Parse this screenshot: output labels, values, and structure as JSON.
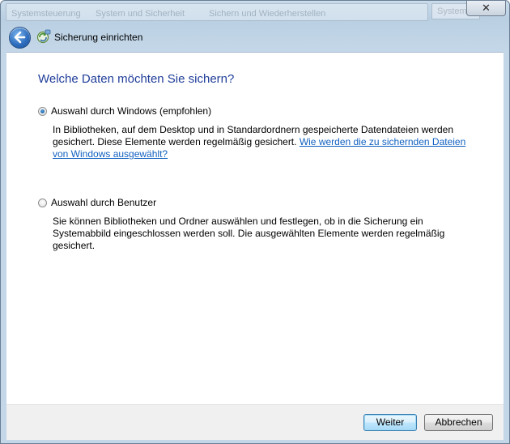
{
  "window": {
    "close_glyph": "✕",
    "background_breadcrumb": [
      "Systemsteuerung",
      "System und Sicherheit",
      "Sichern und Wiederherstellen"
    ],
    "background_search": "Systemste"
  },
  "dialog": {
    "title": "Sicherung einrichten",
    "heading": "Welche Daten möchten Sie sichern?",
    "options": [
      {
        "label": "Auswahl durch Windows (empfohlen)",
        "selected": true,
        "description_line1": "In Bibliotheken, auf dem Desktop und in Standardordnern gespeicherte Datendateien werden",
        "description_line2_text": "gesichert. Diese Elemente werden regelmäßig gesichert. ",
        "description_link": "Wie werden die zu sichernden Dateien von Windows ausgewählt?"
      },
      {
        "label": "Auswahl durch Benutzer",
        "selected": false,
        "description": "Sie können Bibliotheken und Ordner auswählen und festlegen, ob in die Sicherung ein Systemabbild eingeschlossen werden soll. Die ausgewählten Elemente werden regelmäßig gesichert."
      }
    ]
  },
  "buttons": {
    "next": "Weiter",
    "cancel": "Abbrechen"
  },
  "colors": {
    "heading": "#1f3d99",
    "link": "#1060c0",
    "frame": "#c4d7e8"
  }
}
